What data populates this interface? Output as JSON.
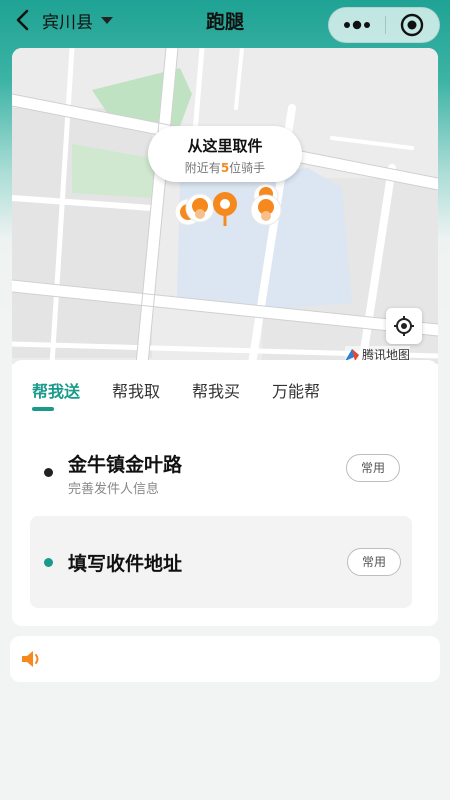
{
  "header": {
    "location": "宾川县",
    "title": "跑腿",
    "back_icon": "chevron-left-icon",
    "more_icon": "more-dots-icon",
    "close_icon": "target-circle-icon"
  },
  "map": {
    "pickup_title": "从这里取件",
    "pickup_prefix": "附近有",
    "rider_count": "5",
    "pickup_suffix": "位骑手",
    "brand": "腾讯地图",
    "locate_icon": "crosshair-icon"
  },
  "tabs": [
    {
      "label": "帮我送"
    },
    {
      "label": "帮我取"
    },
    {
      "label": "帮我买"
    },
    {
      "label": "万能帮"
    }
  ],
  "sender": {
    "address": "金牛镇金叶路",
    "hint": "完善发件人信息",
    "chip": "常用"
  },
  "receiver": {
    "placeholder": "填写收件地址",
    "chip": "常用"
  },
  "notice": {
    "icon": "speaker-icon",
    "text": ""
  },
  "colors": {
    "accent": "#1a9a8c",
    "highlight": "#f5891e"
  }
}
